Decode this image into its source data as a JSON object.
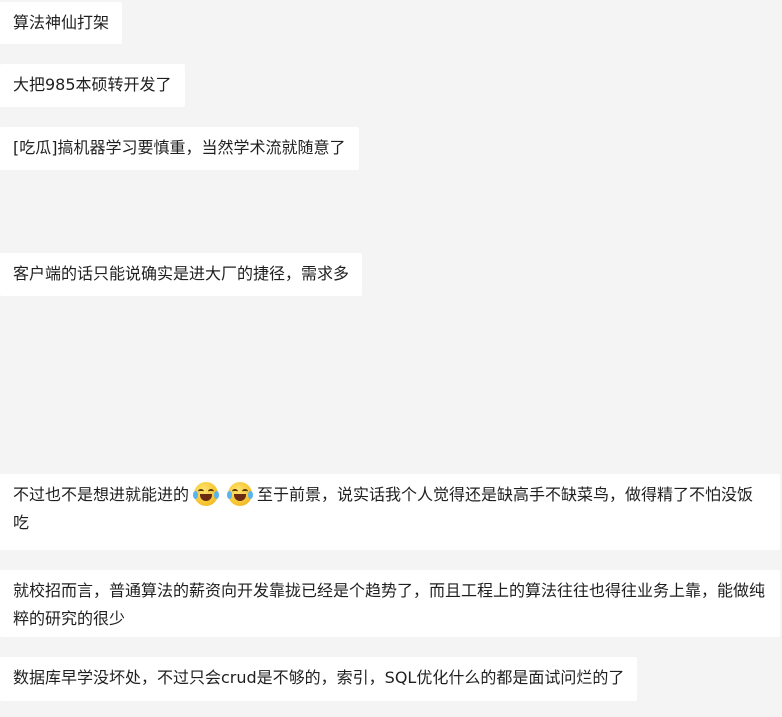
{
  "messages": [
    {
      "text": "算法神仙打架"
    },
    {
      "text": "大把985本硕转开发了"
    },
    {
      "text": "[吃瓜]搞机器学习要慎重，当然学术流就随意了"
    },
    {
      "text": "客户端的话只能说确实是进大厂的捷径，需求多"
    },
    {
      "part1": "不过也不是想进就能进的",
      "emoji1": "face-with-tears-of-joy-emoji",
      "emoji2": "face-with-tears-of-joy-emoji",
      "part2": "至于前景，说实话我个人觉得还是缺高手不缺菜鸟，做得精了不怕没饭吃"
    },
    {
      "text": "就校招而言，普通算法的薪资向开发靠拢已经是个趋势了，而且工程上的算法往往也得往业务上靠，能做纯粹的研究的很少"
    },
    {
      "text": "数据库早学没坏处，不过只会crud是不够的，索引，SQL优化什么的都是面试问烂的了"
    }
  ]
}
